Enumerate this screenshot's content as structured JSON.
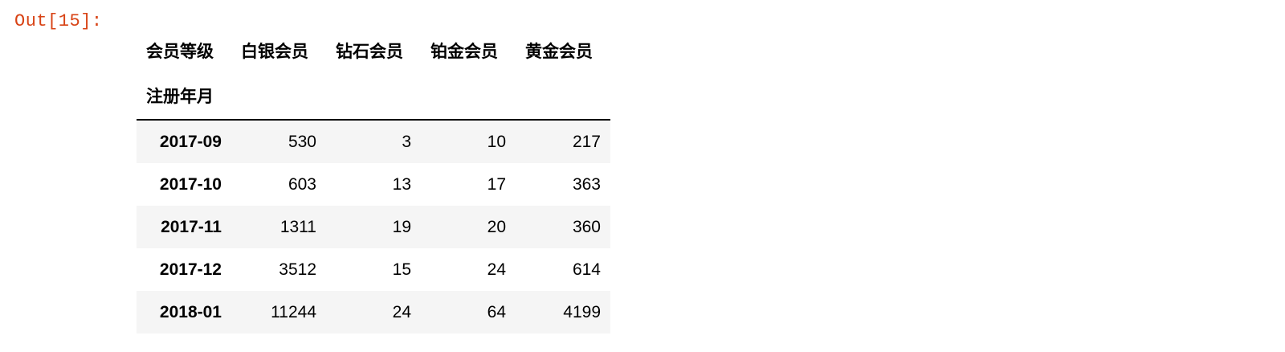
{
  "cell": {
    "prompt": "Out[15]:"
  },
  "table": {
    "columns_name": "会员等级",
    "index_name": "注册年月",
    "columns": [
      "白银会员",
      "钻石会员",
      "铂金会员",
      "黄金会员"
    ],
    "rows": [
      {
        "index": "2017-09",
        "values": [
          "530",
          "3",
          "10",
          "217"
        ]
      },
      {
        "index": "2017-10",
        "values": [
          "603",
          "13",
          "17",
          "363"
        ]
      },
      {
        "index": "2017-11",
        "values": [
          "1311",
          "19",
          "20",
          "360"
        ]
      },
      {
        "index": "2017-12",
        "values": [
          "3512",
          "15",
          "24",
          "614"
        ]
      },
      {
        "index": "2018-01",
        "values": [
          "11244",
          "24",
          "64",
          "4199"
        ]
      }
    ]
  },
  "colors": {
    "prompt": "#d84315",
    "stripe": "#f5f5f5"
  }
}
